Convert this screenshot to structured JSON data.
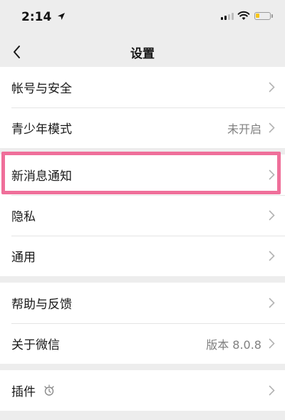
{
  "status_bar": {
    "time": "2:14",
    "location_icon": "location-arrow-icon",
    "signal_icon": "cellular-signal-icon",
    "wifi_icon": "wifi-icon",
    "battery_icon": "battery-icon",
    "battery_level": 0.3,
    "battery_color": "#f5c518"
  },
  "nav": {
    "back_icon": "chevron-left-icon",
    "title": "设置"
  },
  "groups": [
    {
      "items": [
        {
          "label": "帐号与安全",
          "value": ""
        },
        {
          "label": "青少年模式",
          "value": "未开启"
        }
      ]
    },
    {
      "items": [
        {
          "label": "新消息通知",
          "value": "",
          "highlighted": true
        },
        {
          "label": "隐私",
          "value": ""
        },
        {
          "label": "通用",
          "value": ""
        }
      ]
    },
    {
      "items": [
        {
          "label": "帮助与反馈",
          "value": ""
        },
        {
          "label": "关于微信",
          "value": "版本 8.0.8"
        }
      ]
    },
    {
      "items": [
        {
          "label": "插件",
          "value": "",
          "icon": "plugin-bulb-icon"
        }
      ]
    }
  ],
  "colors": {
    "background": "#ededed",
    "card": "#ffffff",
    "highlight_border": "#ef6f9a",
    "secondary_text": "#808080"
  }
}
